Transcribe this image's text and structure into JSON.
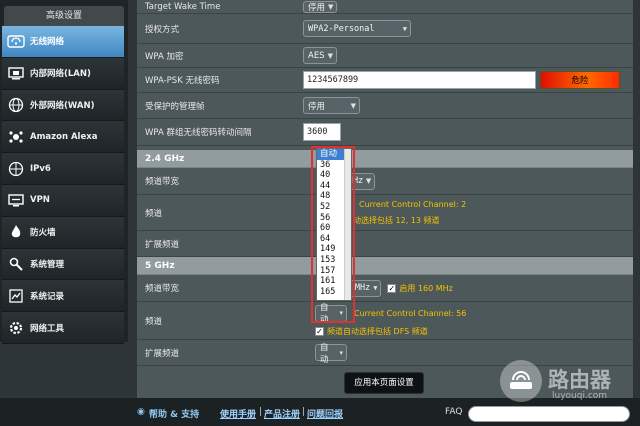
{
  "sidebar": {
    "header": "高级设置",
    "items": [
      {
        "label": "无线网络",
        "icon": "wifi-icon",
        "active": true
      },
      {
        "label": "内部网络(LAN)",
        "icon": "lan-icon",
        "active": false
      },
      {
        "label": "外部网络(WAN)",
        "icon": "globe-icon",
        "active": false
      },
      {
        "label": "Amazon Alexa",
        "icon": "alexa-icon",
        "active": false
      },
      {
        "label": "IPv6",
        "icon": "ipv6-icon",
        "active": false
      },
      {
        "label": "VPN",
        "icon": "vpn-icon",
        "active": false
      },
      {
        "label": "防火墙",
        "icon": "firewall-icon",
        "active": false
      },
      {
        "label": "系统管理",
        "icon": "admin-icon",
        "active": false
      },
      {
        "label": "系统记录",
        "icon": "log-icon",
        "active": false
      },
      {
        "label": "网络工具",
        "icon": "tools-icon",
        "active": false
      }
    ]
  },
  "form": {
    "target_wake_time": {
      "label": "Target Wake Time",
      "value": "停用"
    },
    "auth_method": {
      "label": "授权方式",
      "value": "WPA2-Personal"
    },
    "wpa_encryption": {
      "label": "WPA 加密",
      "value": "AES"
    },
    "wpa_psk": {
      "label": "WPA-PSK 无线密码",
      "value": "1234567899",
      "strength": "危险"
    },
    "protected_mgmt": {
      "label": "受保护的管理帧",
      "value": "停用"
    },
    "group_key_interval": {
      "label": "WPA 群组无线密码转动间隔",
      "value": "3600"
    }
  },
  "band_24": {
    "section": "2.4 GHz",
    "bandwidth_label": "频道带宽",
    "bandwidth_value": "Hz",
    "channel_label": "频道",
    "current_channel": "Current Control Channel: 2",
    "auto_note": "动选择包括 12, 13 频道",
    "ext_channel_label": "扩展频道"
  },
  "band_5": {
    "section": "5 GHz",
    "bandwidth_label": "频道带宽",
    "bandwidth_value": "80/160 MHz",
    "enable_160_label": "启用 160 MHz",
    "channel_label": "频道",
    "channel_value": "自动",
    "current_channel": "Current Control Channel: 56",
    "dfs_note": "频道自动选择包括 DFS 频道",
    "ext_channel_label": "扩展频道",
    "ext_channel_value": "自动"
  },
  "channel_dropdown": {
    "options": [
      "自动",
      "36",
      "40",
      "44",
      "48",
      "52",
      "56",
      "60",
      "64",
      "149",
      "153",
      "157",
      "161",
      "165"
    ],
    "selected": "自动"
  },
  "apply_button": "应用本页面设置",
  "footer": {
    "help": "帮助 & 支持",
    "manual": "使用手册",
    "register": "产品注册",
    "feedback": "问题回报",
    "sep": "|",
    "faq": "FAQ"
  },
  "watermark": {
    "title": "路由器",
    "subtitle": "luyouqi.com"
  },
  "colors": {
    "accent": "#3f87c2",
    "warning": "#f5c200",
    "danger": "#e01000"
  }
}
